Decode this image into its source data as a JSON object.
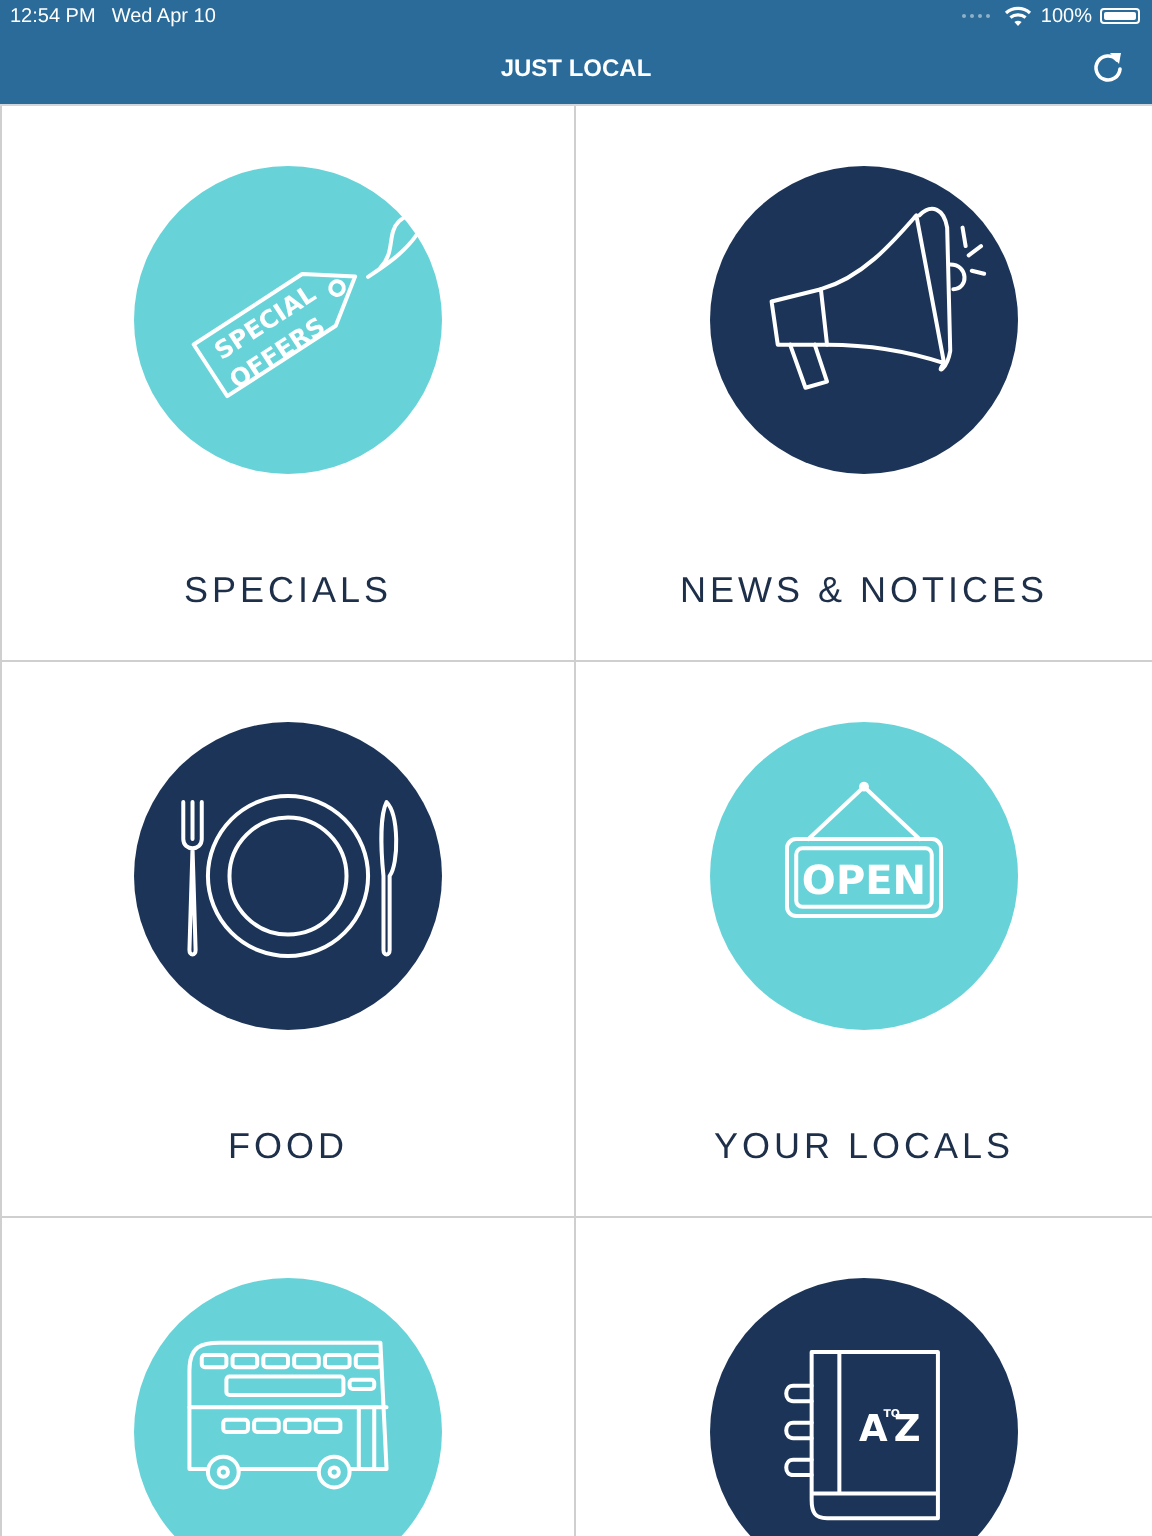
{
  "status_bar": {
    "time": "12:54 PM",
    "date": "Wed Apr 10",
    "battery": "100%"
  },
  "nav_bar": {
    "title": "JUST LOCAL"
  },
  "tiles": [
    {
      "kind": "tag",
      "color": "#67d3d8",
      "label": "SPECIALS",
      "icon_text": [
        "SPECIAL",
        "OFFERS"
      ]
    },
    {
      "kind": "megaphone",
      "color": "#1c3457",
      "label": "NEWS & NOTICES"
    },
    {
      "kind": "plate",
      "color": "#1c3457",
      "label": "FOOD"
    },
    {
      "kind": "sign",
      "color": "#67d3d8",
      "label": "YOUR LOCALS",
      "icon_text": [
        "OPEN"
      ]
    },
    {
      "kind": "bus",
      "color": "#67d3d8"
    },
    {
      "kind": "book",
      "color": "#1c3457",
      "icon_text": [
        "A",
        "TO",
        "Z"
      ]
    }
  ]
}
